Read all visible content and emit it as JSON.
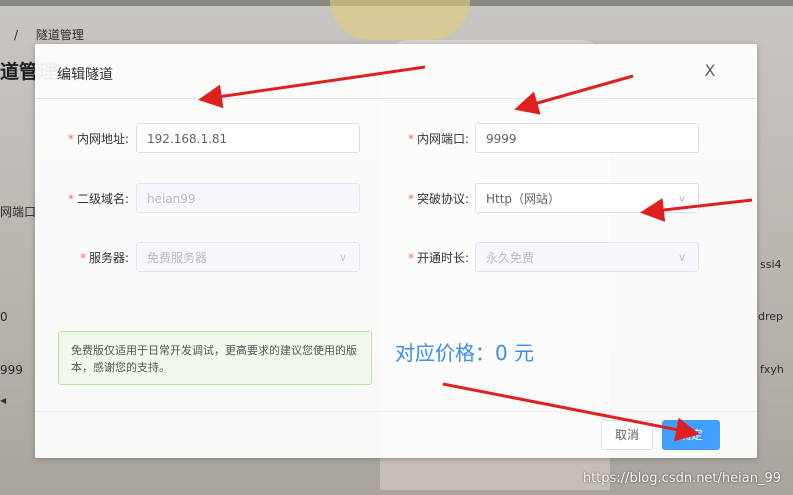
{
  "background": {
    "breadcrumb_sep": "/",
    "breadcrumb_item": "隧道管理",
    "page_title": "道管理",
    "left_cells": [
      "网端口",
      "0",
      "999"
    ],
    "right_cells": [
      "ssi4",
      "drep",
      "fxyh"
    ],
    "scroll_arrow": "◀"
  },
  "dialog": {
    "title": "编辑隧道",
    "close_glyph": "X",
    "fields": {
      "inner_addr": {
        "label": "内网地址:",
        "value": "192.168.1.81"
      },
      "inner_port": {
        "label": "内网端口:",
        "value": "9999"
      },
      "subdomain": {
        "label": "二级域名:",
        "value": "heian99"
      },
      "protocol": {
        "label": "突破协议:",
        "value": "Http（网站）"
      },
      "server": {
        "label": "服务器:",
        "value": "免费服务器"
      },
      "duration": {
        "label": "开通时长:",
        "value": "永久免费"
      }
    },
    "required_mark": "*",
    "notice": "免费版仅适用于日常开发调试，更高要求的建议您使用的版本，感谢您的支持。",
    "price": "对应价格：0 元",
    "buttons": {
      "cancel": "取消",
      "ok": "确定"
    }
  },
  "icons": {
    "close": "close-icon",
    "chevron": "chevron-down-icon"
  },
  "colors": {
    "primary": "#409eff",
    "required": "#f56c6c",
    "arrow": "#e02020",
    "notice_bg": "#f0f9eb",
    "price": "#3a8ee6"
  },
  "watermark": "https://blog.csdn.net/heian_99"
}
